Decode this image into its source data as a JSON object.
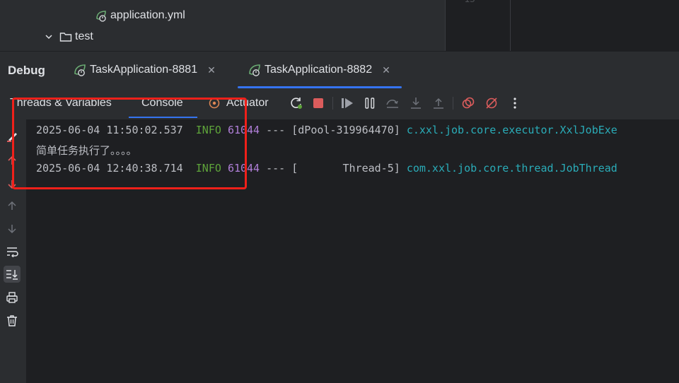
{
  "project_tree": {
    "items": [
      {
        "label": "application.yml",
        "type": "yaml"
      },
      {
        "label": "test",
        "type": "folder"
      }
    ],
    "gutter_line_number": "15"
  },
  "debug": {
    "title": "Debug",
    "run_tabs": [
      {
        "label": "TaskApplication-8881",
        "active": false
      },
      {
        "label": "TaskApplication-8882",
        "active": true
      }
    ]
  },
  "toolbar": {
    "tabs": [
      {
        "label": "Threads & Variables",
        "active": false
      },
      {
        "label": "Console",
        "active": true
      },
      {
        "label": "Actuator",
        "active": false
      }
    ],
    "buttons": [
      "rerun-icon",
      "stop-icon",
      "resume-icon",
      "pause-icon",
      "step-over-icon",
      "step-into-icon",
      "step-out-icon",
      "view-breakpoints-icon",
      "mute-breakpoints-icon",
      "more-icon"
    ]
  },
  "console": {
    "lines": [
      {
        "time": "2025-06-04 11:50:02.537",
        "level": "INFO",
        "pid": "61044",
        "sep": "---",
        "thread": "[dPool-319964470]",
        "logger": "c.xxl.job.core.executor.XxlJobExe"
      },
      {
        "text": "简单任务执行了。。。。"
      },
      {
        "time": "2025-06-04 12:40:38.714",
        "level": "INFO",
        "pid": "61044",
        "sep": "---",
        "thread": "[       Thread-5]",
        "logger": "com.xxl.job.core.thread.JobThread"
      }
    ]
  },
  "colors": {
    "accent": "#3574f0",
    "annotation": "#f0201a",
    "log_info": "#5ea33a",
    "log_pid": "#b07fd8",
    "log_logger": "#2aacb8"
  }
}
